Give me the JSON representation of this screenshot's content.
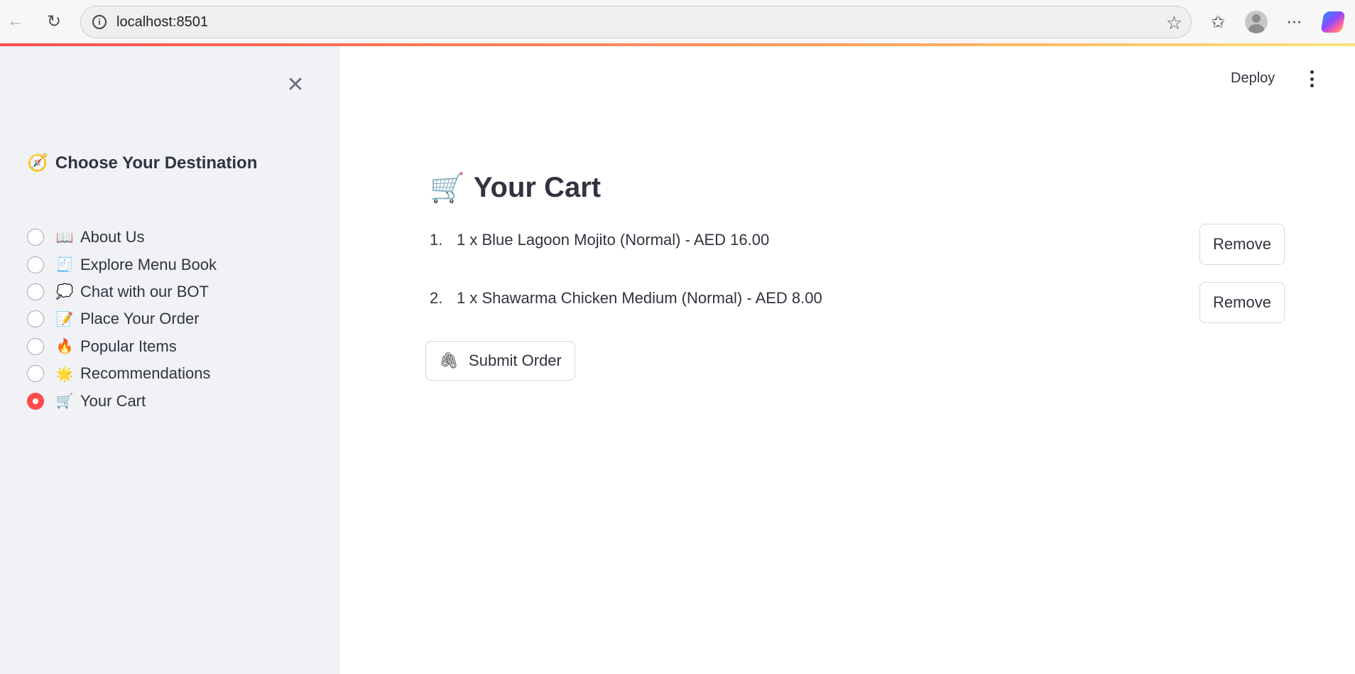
{
  "browser": {
    "url": "localhost:8501",
    "icons": {
      "back": "arrow-left-icon",
      "reload": "reload-icon",
      "info": "info-icon",
      "favorite": "star-icon",
      "favorites_list": "favorites-icon",
      "profile": "profile-icon",
      "more": "more-icon",
      "copilot": "copilot-icon"
    }
  },
  "colors": {
    "accent": "#ff4b4b",
    "sidebar_bg": "#f0f2f6",
    "text": "#31333f"
  },
  "sidebar": {
    "title_emoji": "🧭",
    "title": "Choose Your Destination",
    "items": [
      {
        "emoji": "📖",
        "label": "About Us",
        "selected": false
      },
      {
        "emoji": "🧾",
        "label": "Explore Menu Book",
        "selected": false
      },
      {
        "emoji": "💭",
        "label": "Chat with our BOT",
        "selected": false
      },
      {
        "emoji": "📝",
        "label": "Place Your Order",
        "selected": false
      },
      {
        "emoji": "🔥",
        "label": "Popular Items",
        "selected": false
      },
      {
        "emoji": "🌟",
        "label": "Recommendations",
        "selected": false
      },
      {
        "emoji": "🛒",
        "label": "Your Cart",
        "selected": true
      }
    ]
  },
  "header": {
    "deploy_label": "Deploy"
  },
  "main": {
    "title_emoji": "🛒",
    "title": "Your Cart",
    "cart_items": [
      {
        "index": "1.",
        "text": "1 x Blue Lagoon Mojito (Normal) - AED 16.00",
        "remove_label": "Remove"
      },
      {
        "index": "2.",
        "text": "1 x Shawarma Chicken Medium (Normal) - AED 8.00",
        "remove_label": "Remove"
      }
    ],
    "submit_emoji": "🖇",
    "submit_label": "Submit Order"
  }
}
